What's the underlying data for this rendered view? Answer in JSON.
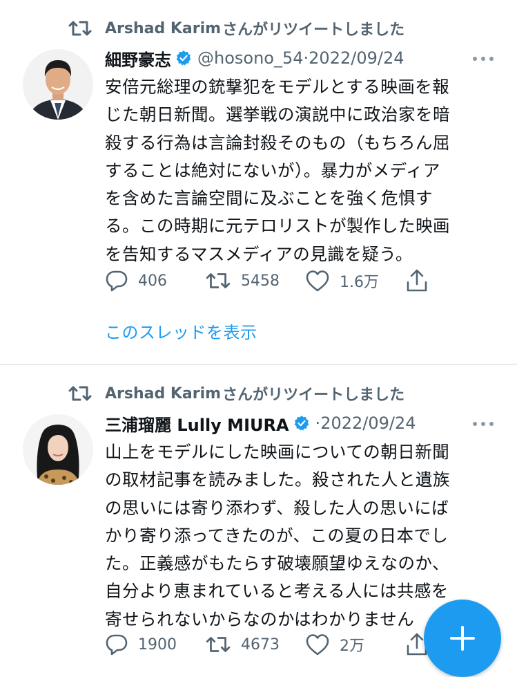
{
  "tweets": [
    {
      "retweeted_by": "Arshad Karim",
      "retweet_suffix": "さんがリツイートしました",
      "name": "細野豪志",
      "handle": "@hosono_54",
      "separator": "·",
      "date": "2022/09/24",
      "body_lines": [
        "安倍元総理の銃撃犯をモデルとする映画を報",
        "じた朝日新聞。選挙戦の演説中に政治家を暗",
        "殺する行為は言論封殺そのもの（もちろん屈",
        "することは絶対にないが）。暴力がメディア",
        "を含めた言論空間に及ぶことを強く危惧す",
        "る。この時期に元テロリストが製作した映画",
        "を告知するマスメディアの見識を疑う。"
      ],
      "replies": "406",
      "retweets": "5458",
      "likes": "1.6万",
      "show_thread": "このスレッドを表示"
    },
    {
      "retweeted_by": "Arshad Karim",
      "retweet_suffix": "さんがリツイートしました",
      "name": "三浦瑠麗 Lully MIURA",
      "handle": "",
      "separator": "·",
      "date": "2022/09/24",
      "body_lines": [
        "山上をモデルにした映画についての朝日新聞",
        "の取材記事を読みました。殺された人と遺族",
        "の思いには寄り添わず、殺した人の思いにば",
        "かり寄り添ってきたのが、この夏の日本でし",
        "た。正義感がもたらす破壊願望ゆえなのか、",
        "自分より恵まれていると考える人には共感を",
        "寄せられないからなのかはわかりません"
      ],
      "replies": "1900",
      "retweets": "4673",
      "likes": "2万"
    }
  ],
  "colors": {
    "accent": "#1d9bf0",
    "muted_text": "#536471",
    "primary_text": "#0f1419",
    "divider": "#e6ecf0"
  },
  "icons": {
    "retweet": "retweet-icon",
    "verified": "verified-badge-icon",
    "reply": "reply-icon",
    "like": "heart-icon",
    "share": "share-icon",
    "compose": "plus-icon"
  }
}
